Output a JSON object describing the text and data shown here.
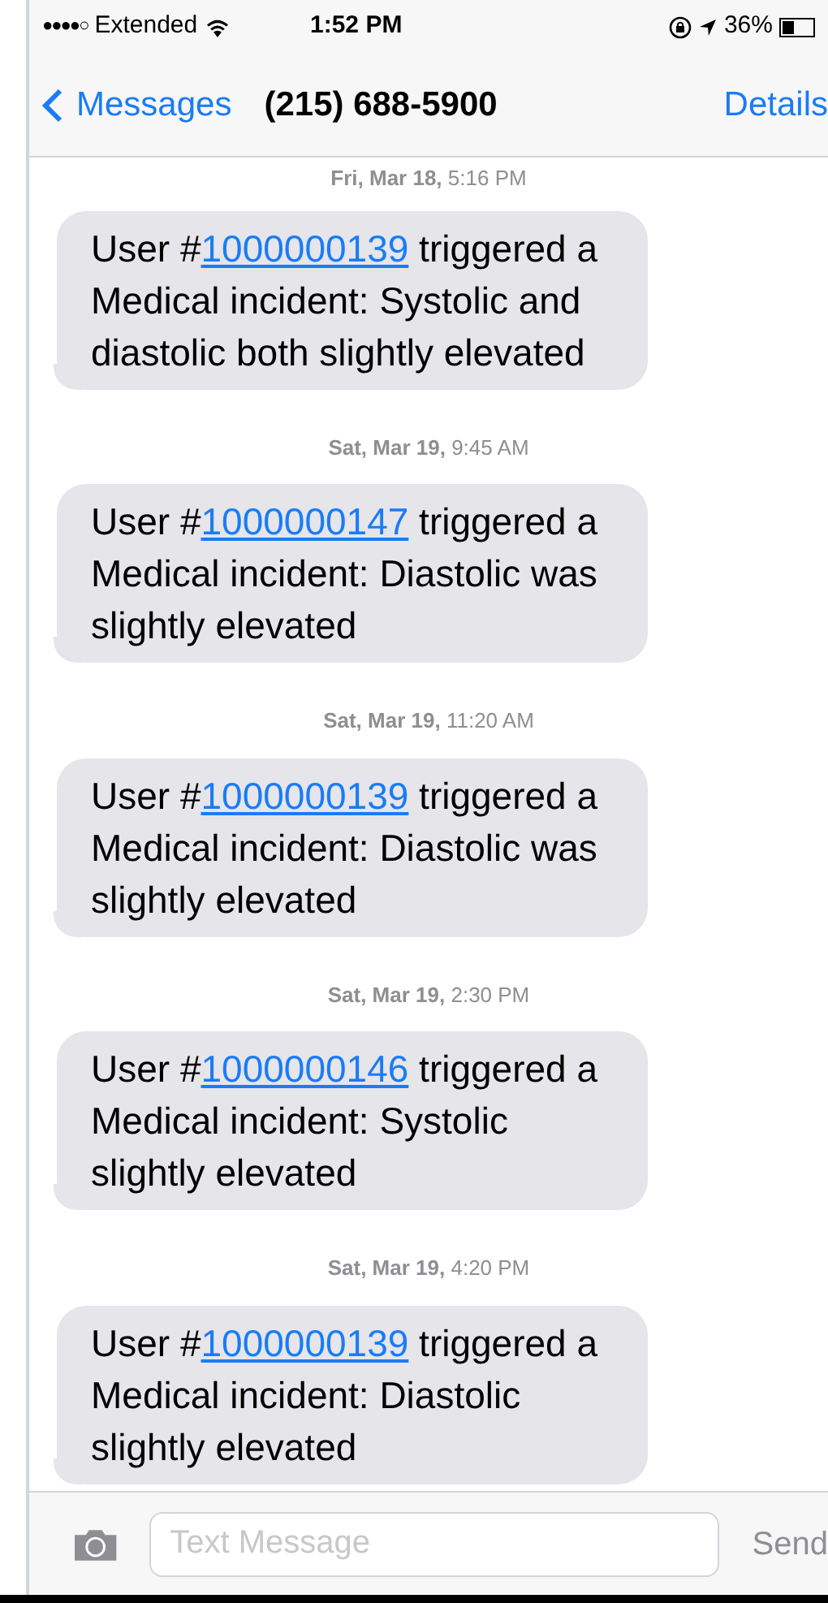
{
  "status_bar": {
    "signal": "●●●●○",
    "carrier": "Extended",
    "time": "1:52 PM",
    "battery_percent": "36%"
  },
  "nav_bar": {
    "back_label": "Messages",
    "title": "(215) 688-5900",
    "action": "Details"
  },
  "messages": [
    {
      "timestamp": "**Fri, Mar 18,** 5:16 PM",
      "text_before": "User #",
      "link": "1000000139",
      "text_after": " triggered a Medical incident: Systolic and diastolic both slightly elevated"
    },
    {
      "timestamp": "**Sat, Mar 19,** 9:45 AM",
      "text_before": "User #",
      "link": "1000000147",
      "text_after": " triggered a Medical incident: Diastolic was slightly elevated"
    },
    {
      "timestamp": "**Sat, Mar 19,** 11:20 AM",
      "text_before": "User #",
      "link": "1000000139",
      "text_after": " triggered a Medical incident: Diastolic was slightly elevated"
    },
    {
      "timestamp": "**Sat, Mar 19,** 2:30 PM",
      "text_before": "User #",
      "link": "1000000146",
      "text_after": " triggered a Medical incident: Systolic slightly elevated"
    },
    {
      "timestamp": "**Sat, Mar 19,** 4:20 PM",
      "text_before": "User #",
      "link": "1000000139",
      "text_after": " triggered a Medical incident: Diastolic slightly elevated"
    }
  ],
  "input_bar": {
    "placeholder": "Text Message",
    "send_label": "Send"
  }
}
